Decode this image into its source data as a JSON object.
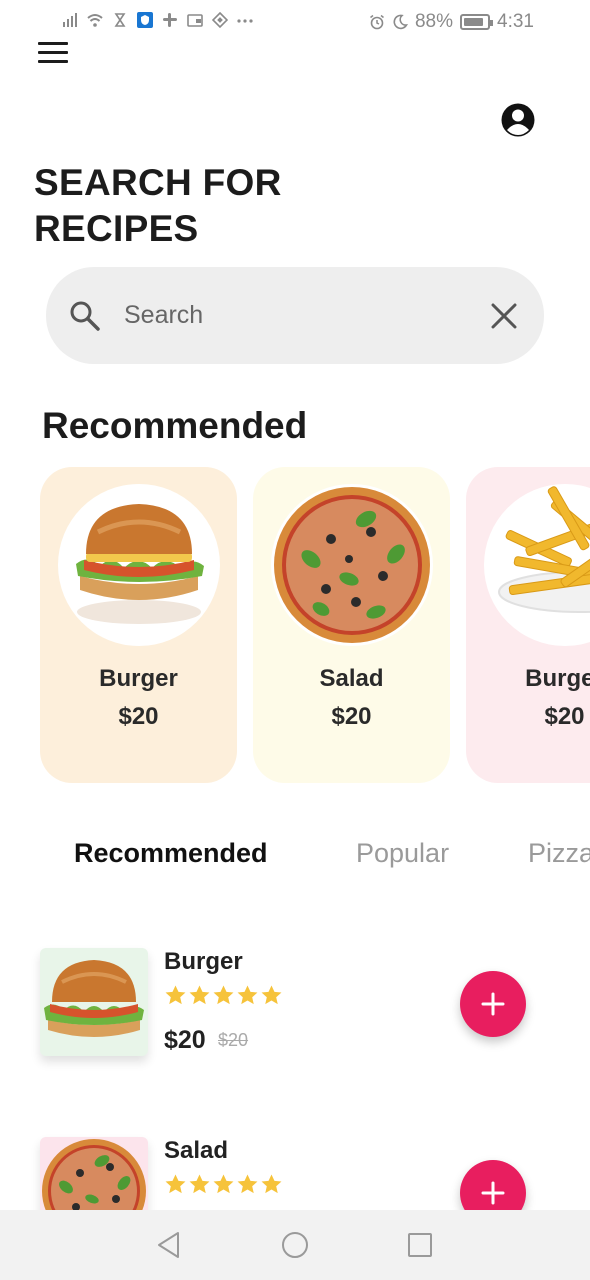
{
  "status_bar": {
    "battery": "88%",
    "battery_level": 0.88,
    "time": "4:31",
    "icons_left": [
      "signal-icon",
      "wifi-icon",
      "hourglass-icon",
      "vpn-shield-icon",
      "slack-icon",
      "wallet-icon",
      "binance-icon",
      "more-dots-icon"
    ],
    "icons_right": [
      "alarm-icon",
      "moon-icon",
      "battery-icon"
    ]
  },
  "header": {
    "menu_icon": "hamburger-menu-icon",
    "profile_icon": "account-circle-icon",
    "title": "SEARCH FOR RECIPES"
  },
  "search": {
    "placeholder": "Search",
    "value": "",
    "clear_icon": "close-icon"
  },
  "recommended": {
    "title": "Recommended",
    "cards": [
      {
        "name": "Burger",
        "price": "$20",
        "bg": "#fdefdb",
        "image": "burger"
      },
      {
        "name": "Salad",
        "price": "$20",
        "bg": "#fefbe8",
        "image": "pizza"
      },
      {
        "name": "Burger",
        "price": "$20",
        "bg": "#fdebee",
        "image": "fries"
      }
    ]
  },
  "tabs": [
    {
      "label": "Recommended",
      "active": true
    },
    {
      "label": "Popular",
      "active": false
    },
    {
      "label": "Pizza",
      "active": false
    }
  ],
  "items": [
    {
      "name": "Burger",
      "rating": 5,
      "price": "$20",
      "old_price": "$20",
      "thumb_bg": "#e8f5e9",
      "image": "burger"
    },
    {
      "name": "Salad",
      "rating": 5,
      "price": "",
      "old_price": "",
      "thumb_bg": "#fce4ec",
      "image": "pizza"
    }
  ],
  "colors": {
    "accent": "#e81e5f",
    "star": "#f6c33b",
    "search_bg": "#eeeeee"
  },
  "nav_bar": [
    "back-icon",
    "home-icon",
    "recents-icon"
  ]
}
